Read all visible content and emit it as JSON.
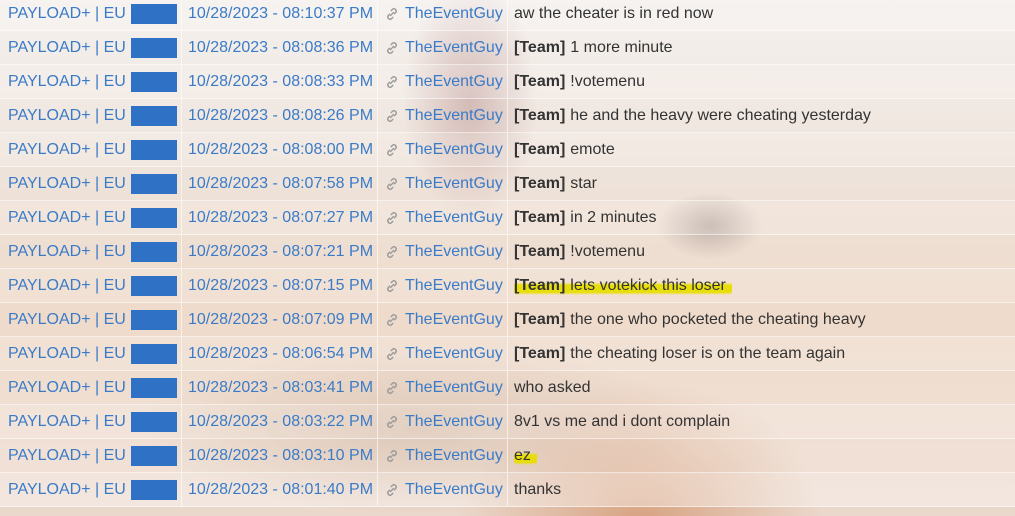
{
  "rows": [
    {
      "server": "PAYLOAD+ | EU",
      "time": "10/28/2023 - 08:10:37 PM",
      "player": "TheEventGuy",
      "team": "",
      "message": "aw the cheater is in red now",
      "highlight": false
    },
    {
      "server": "PAYLOAD+ | EU",
      "time": "10/28/2023 - 08:08:36 PM",
      "player": "TheEventGuy",
      "team": "[Team]",
      "message": "1 more minute",
      "highlight": false
    },
    {
      "server": "PAYLOAD+ | EU",
      "time": "10/28/2023 - 08:08:33 PM",
      "player": "TheEventGuy",
      "team": "[Team]",
      "message": "!votemenu",
      "highlight": false
    },
    {
      "server": "PAYLOAD+ | EU",
      "time": "10/28/2023 - 08:08:26 PM",
      "player": "TheEventGuy",
      "team": "[Team]",
      "message": "he and the heavy were cheating yesterday",
      "highlight": false
    },
    {
      "server": "PAYLOAD+ | EU",
      "time": "10/28/2023 - 08:08:00 PM",
      "player": "TheEventGuy",
      "team": "[Team]",
      "message": "emote",
      "highlight": false
    },
    {
      "server": "PAYLOAD+ | EU",
      "time": "10/28/2023 - 08:07:58 PM",
      "player": "TheEventGuy",
      "team": "[Team]",
      "message": "star",
      "highlight": false
    },
    {
      "server": "PAYLOAD+ | EU",
      "time": "10/28/2023 - 08:07:27 PM",
      "player": "TheEventGuy",
      "team": "[Team]",
      "message": "in 2 minutes",
      "highlight": false
    },
    {
      "server": "PAYLOAD+ | EU",
      "time": "10/28/2023 - 08:07:21 PM",
      "player": "TheEventGuy",
      "team": "[Team]",
      "message": "!votemenu",
      "highlight": false
    },
    {
      "server": "PAYLOAD+ | EU",
      "time": "10/28/2023 - 08:07:15 PM",
      "player": "TheEventGuy",
      "team": "[Team]",
      "message": "lets votekick this loser",
      "highlight": true
    },
    {
      "server": "PAYLOAD+ | EU",
      "time": "10/28/2023 - 08:07:09 PM",
      "player": "TheEventGuy",
      "team": "[Team]",
      "message": "the one who pocketed the cheating heavy",
      "highlight": false
    },
    {
      "server": "PAYLOAD+ | EU",
      "time": "10/28/2023 - 08:06:54 PM",
      "player": "TheEventGuy",
      "team": "[Team]",
      "message": "the cheating loser is on the team again",
      "highlight": false
    },
    {
      "server": "PAYLOAD+ | EU",
      "time": "10/28/2023 - 08:03:41 PM",
      "player": "TheEventGuy",
      "team": "",
      "message": "who asked",
      "highlight": false
    },
    {
      "server": "PAYLOAD+ | EU",
      "time": "10/28/2023 - 08:03:22 PM",
      "player": "TheEventGuy",
      "team": "",
      "message": "8v1 vs me and i dont complain",
      "highlight": false
    },
    {
      "server": "PAYLOAD+ | EU",
      "time": "10/28/2023 - 08:03:10 PM",
      "player": "TheEventGuy",
      "team": "",
      "message": "ez",
      "highlight": true
    },
    {
      "server": "PAYLOAD+ | EU",
      "time": "10/28/2023 - 08:01:40 PM",
      "player": "TheEventGuy",
      "team": "",
      "message": "thanks",
      "highlight": false
    }
  ],
  "icons": {
    "player_link": "link-icon",
    "redaction_color": "#2f71c4"
  },
  "colors": {
    "link_text": "#3a7bc8",
    "message_text": "#333333",
    "highlight": "#e8de00"
  }
}
